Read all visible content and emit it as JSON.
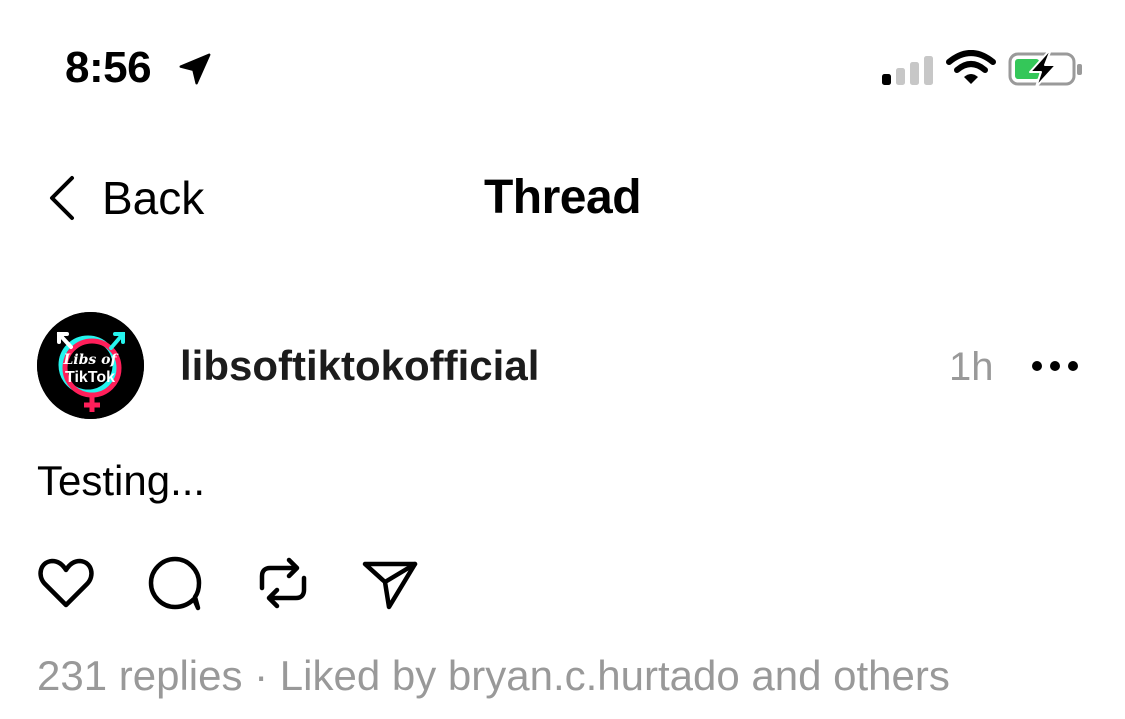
{
  "status_bar": {
    "time": "8:56",
    "location_icon": "location-arrow-icon",
    "signal_icon": "cellular-signal-icon",
    "signal_bars_active": 1,
    "signal_bars_total": 4,
    "wifi_icon": "wifi-icon",
    "battery_icon": "battery-charging-icon",
    "battery_level": 0.45,
    "battery_color": "#34c759"
  },
  "nav": {
    "back_label": "Back",
    "title": "Thread"
  },
  "post": {
    "avatar": {
      "line1": "Libs of",
      "line2": "TikTok",
      "ring_colors": [
        "#ff1f5a",
        "#25f4ee"
      ]
    },
    "username": "libsoftiktokofficial",
    "timestamp": "1h",
    "text": "Testing...",
    "actions": [
      {
        "name": "like",
        "icon": "heart-icon"
      },
      {
        "name": "reply",
        "icon": "comment-bubble-icon"
      },
      {
        "name": "repost",
        "icon": "repost-icon"
      },
      {
        "name": "share",
        "icon": "send-icon"
      }
    ],
    "replies_text": "231 replies",
    "separator": " · ",
    "liked_by_text": "Liked by bryan.c.hurtado and others"
  }
}
